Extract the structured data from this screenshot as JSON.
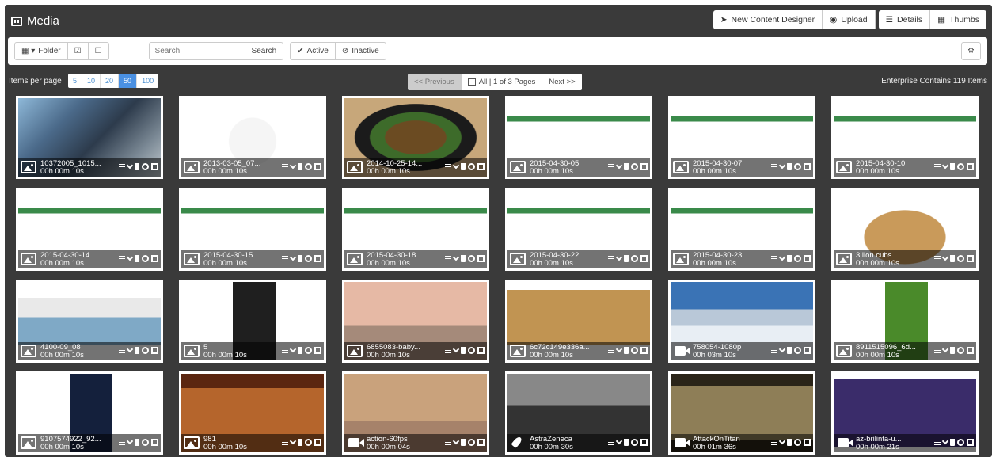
{
  "header": {
    "title": "Media",
    "buttons": {
      "new_designer": "New Content Designer",
      "upload": "Upload",
      "details": "Details",
      "thumbs": "Thumbs"
    }
  },
  "toolbar": {
    "folder_label": "Folder",
    "search_placeholder": "Search",
    "search_button": "Search",
    "active_label": "Active",
    "inactive_label": "Inactive"
  },
  "pagination": {
    "items_per_page_label": "Items per page",
    "page_sizes": [
      "5",
      "10",
      "20",
      "50",
      "100"
    ],
    "active_page_size": "50",
    "previous": "<< Previous",
    "status": "All | 1 of 3 Pages",
    "next": "Next >>",
    "enterprise_count": "Enterprise Contains 119 Items"
  },
  "items": [
    {
      "name": "10372005_1015...",
      "duration": "00h 00m 10s",
      "kind": "image",
      "thumb": "car"
    },
    {
      "name": "2013-03-05_07...",
      "duration": "00h 00m 10s",
      "kind": "image",
      "thumb": "panda"
    },
    {
      "name": "2014-10-25-14...",
      "duration": "00h 00m 10s",
      "kind": "image",
      "thumb": "food"
    },
    {
      "name": "2015-04-30-05",
      "duration": "00h 00m 10s",
      "kind": "image",
      "thumb": "slide"
    },
    {
      "name": "2015-04-30-07",
      "duration": "00h 00m 10s",
      "kind": "image",
      "thumb": "slide"
    },
    {
      "name": "2015-04-30-10",
      "duration": "00h 00m 10s",
      "kind": "image",
      "thumb": "slide"
    },
    {
      "name": "2015-04-30-14",
      "duration": "00h 00m 10s",
      "kind": "image",
      "thumb": "slide"
    },
    {
      "name": "2015-04-30-15",
      "duration": "00h 00m 10s",
      "kind": "image",
      "thumb": "slide"
    },
    {
      "name": "2015-04-30-18",
      "duration": "00h 00m 10s",
      "kind": "image",
      "thumb": "slide"
    },
    {
      "name": "2015-04-30-22",
      "duration": "00h 00m 10s",
      "kind": "image",
      "thumb": "slide"
    },
    {
      "name": "2015-04-30-23",
      "duration": "00h 00m 10s",
      "kind": "image",
      "thumb": "slide"
    },
    {
      "name": "3 lion cubs",
      "duration": "00h 00m 10s",
      "kind": "image",
      "thumb": "lion"
    },
    {
      "name": "4100-09_08",
      "duration": "00h 00m 10s",
      "kind": "image",
      "thumb": "saw"
    },
    {
      "name": "5",
      "duration": "00h 00m 10s",
      "kind": "image",
      "thumb": "dark"
    },
    {
      "name": "6855083-baby...",
      "duration": "00h 00m 10s",
      "kind": "image",
      "thumb": "cat"
    },
    {
      "name": "6c72c149e336a...",
      "duration": "00h 00m 10s",
      "kind": "image",
      "thumb": "lions2"
    },
    {
      "name": "758054-1080p",
      "duration": "00h 03m 10s",
      "kind": "video",
      "thumb": "snow"
    },
    {
      "name": "8911515096_6d...",
      "duration": "00h 00m 10s",
      "kind": "image",
      "thumb": "grass"
    },
    {
      "name": "9107574922_92...",
      "duration": "00h 00m 10s",
      "kind": "image",
      "thumb": "moon"
    },
    {
      "name": "981",
      "duration": "00h 00m 10s",
      "kind": "image",
      "thumb": "menu"
    },
    {
      "name": "action-60fps",
      "duration": "00h 00m 04s",
      "kind": "video",
      "thumb": "desert"
    },
    {
      "name": "AstraZeneca",
      "duration": "00h 00m 30s",
      "kind": "rocket",
      "thumb": "family"
    },
    {
      "name": "AttackOnTitan",
      "duration": "00h 01m 36s",
      "kind": "video",
      "thumb": "titan"
    },
    {
      "name": "az-brilinta-u...",
      "duration": "00h 00m 21s",
      "kind": "video",
      "thumb": "info"
    }
  ]
}
